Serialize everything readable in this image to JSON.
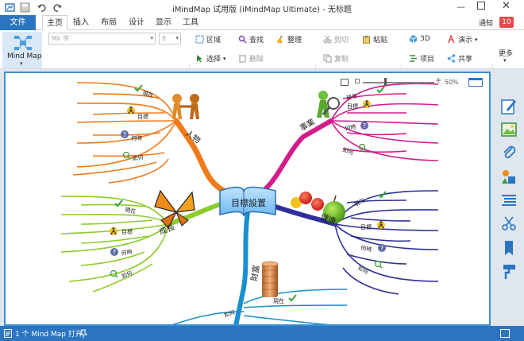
{
  "window": {
    "title": "iMindMap 试用版 (iMindMap Ultimate) - 无标题",
    "quick_access": [
      "save-icon",
      "undo-icon",
      "redo-icon"
    ]
  },
  "tabs": [
    {
      "label": "文件"
    },
    {
      "label": "主页"
    },
    {
      "label": "插入"
    },
    {
      "label": "布局"
    },
    {
      "label": "设计"
    },
    {
      "label": "显示"
    },
    {
      "label": "工具"
    }
  ],
  "notifications": {
    "label": "通知",
    "count": "10"
  },
  "ribbon": {
    "mindmap_label": "Mind Map",
    "font_placeholder": "Mk 字",
    "size_placeholder": "8",
    "region": "区域",
    "select": "选择",
    "find": "查找",
    "delete": "删除",
    "tidy": "整理",
    "cut": "剪切",
    "copy": "复制",
    "paste": "粘贴",
    "threed": "3D",
    "project": "项目",
    "present": "演示",
    "share": "共享",
    "more": "更多"
  },
  "zoom": {
    "value": "50%"
  },
  "mindmap": {
    "central": "目標設置",
    "branches": [
      {
        "name": "人物",
        "color": "#f07a1a",
        "children": [
          "現在",
          "目標",
          "何時",
          "如何"
        ]
      },
      {
        "name": "事業",
        "color": "#d41b8c",
        "children": [
          "現在",
          "目標",
          "何時",
          "如何"
        ]
      },
      {
        "name": "成長",
        "color": "#8ccc2a",
        "children": [
          "現在",
          "目標",
          "何時",
          "如何"
        ]
      },
      {
        "name": "健康",
        "color": "#2f2f9a",
        "children": [
          "現在",
          "目標",
          "何時",
          "如何"
        ]
      },
      {
        "name": "財富",
        "color": "#1a8fd0",
        "children": [
          "現在",
          "如何"
        ]
      }
    ]
  },
  "status": {
    "text": "1 个 Mind Map 打开"
  },
  "colors": {
    "accent": "#2b75c2",
    "badge": "#e24b4b"
  }
}
